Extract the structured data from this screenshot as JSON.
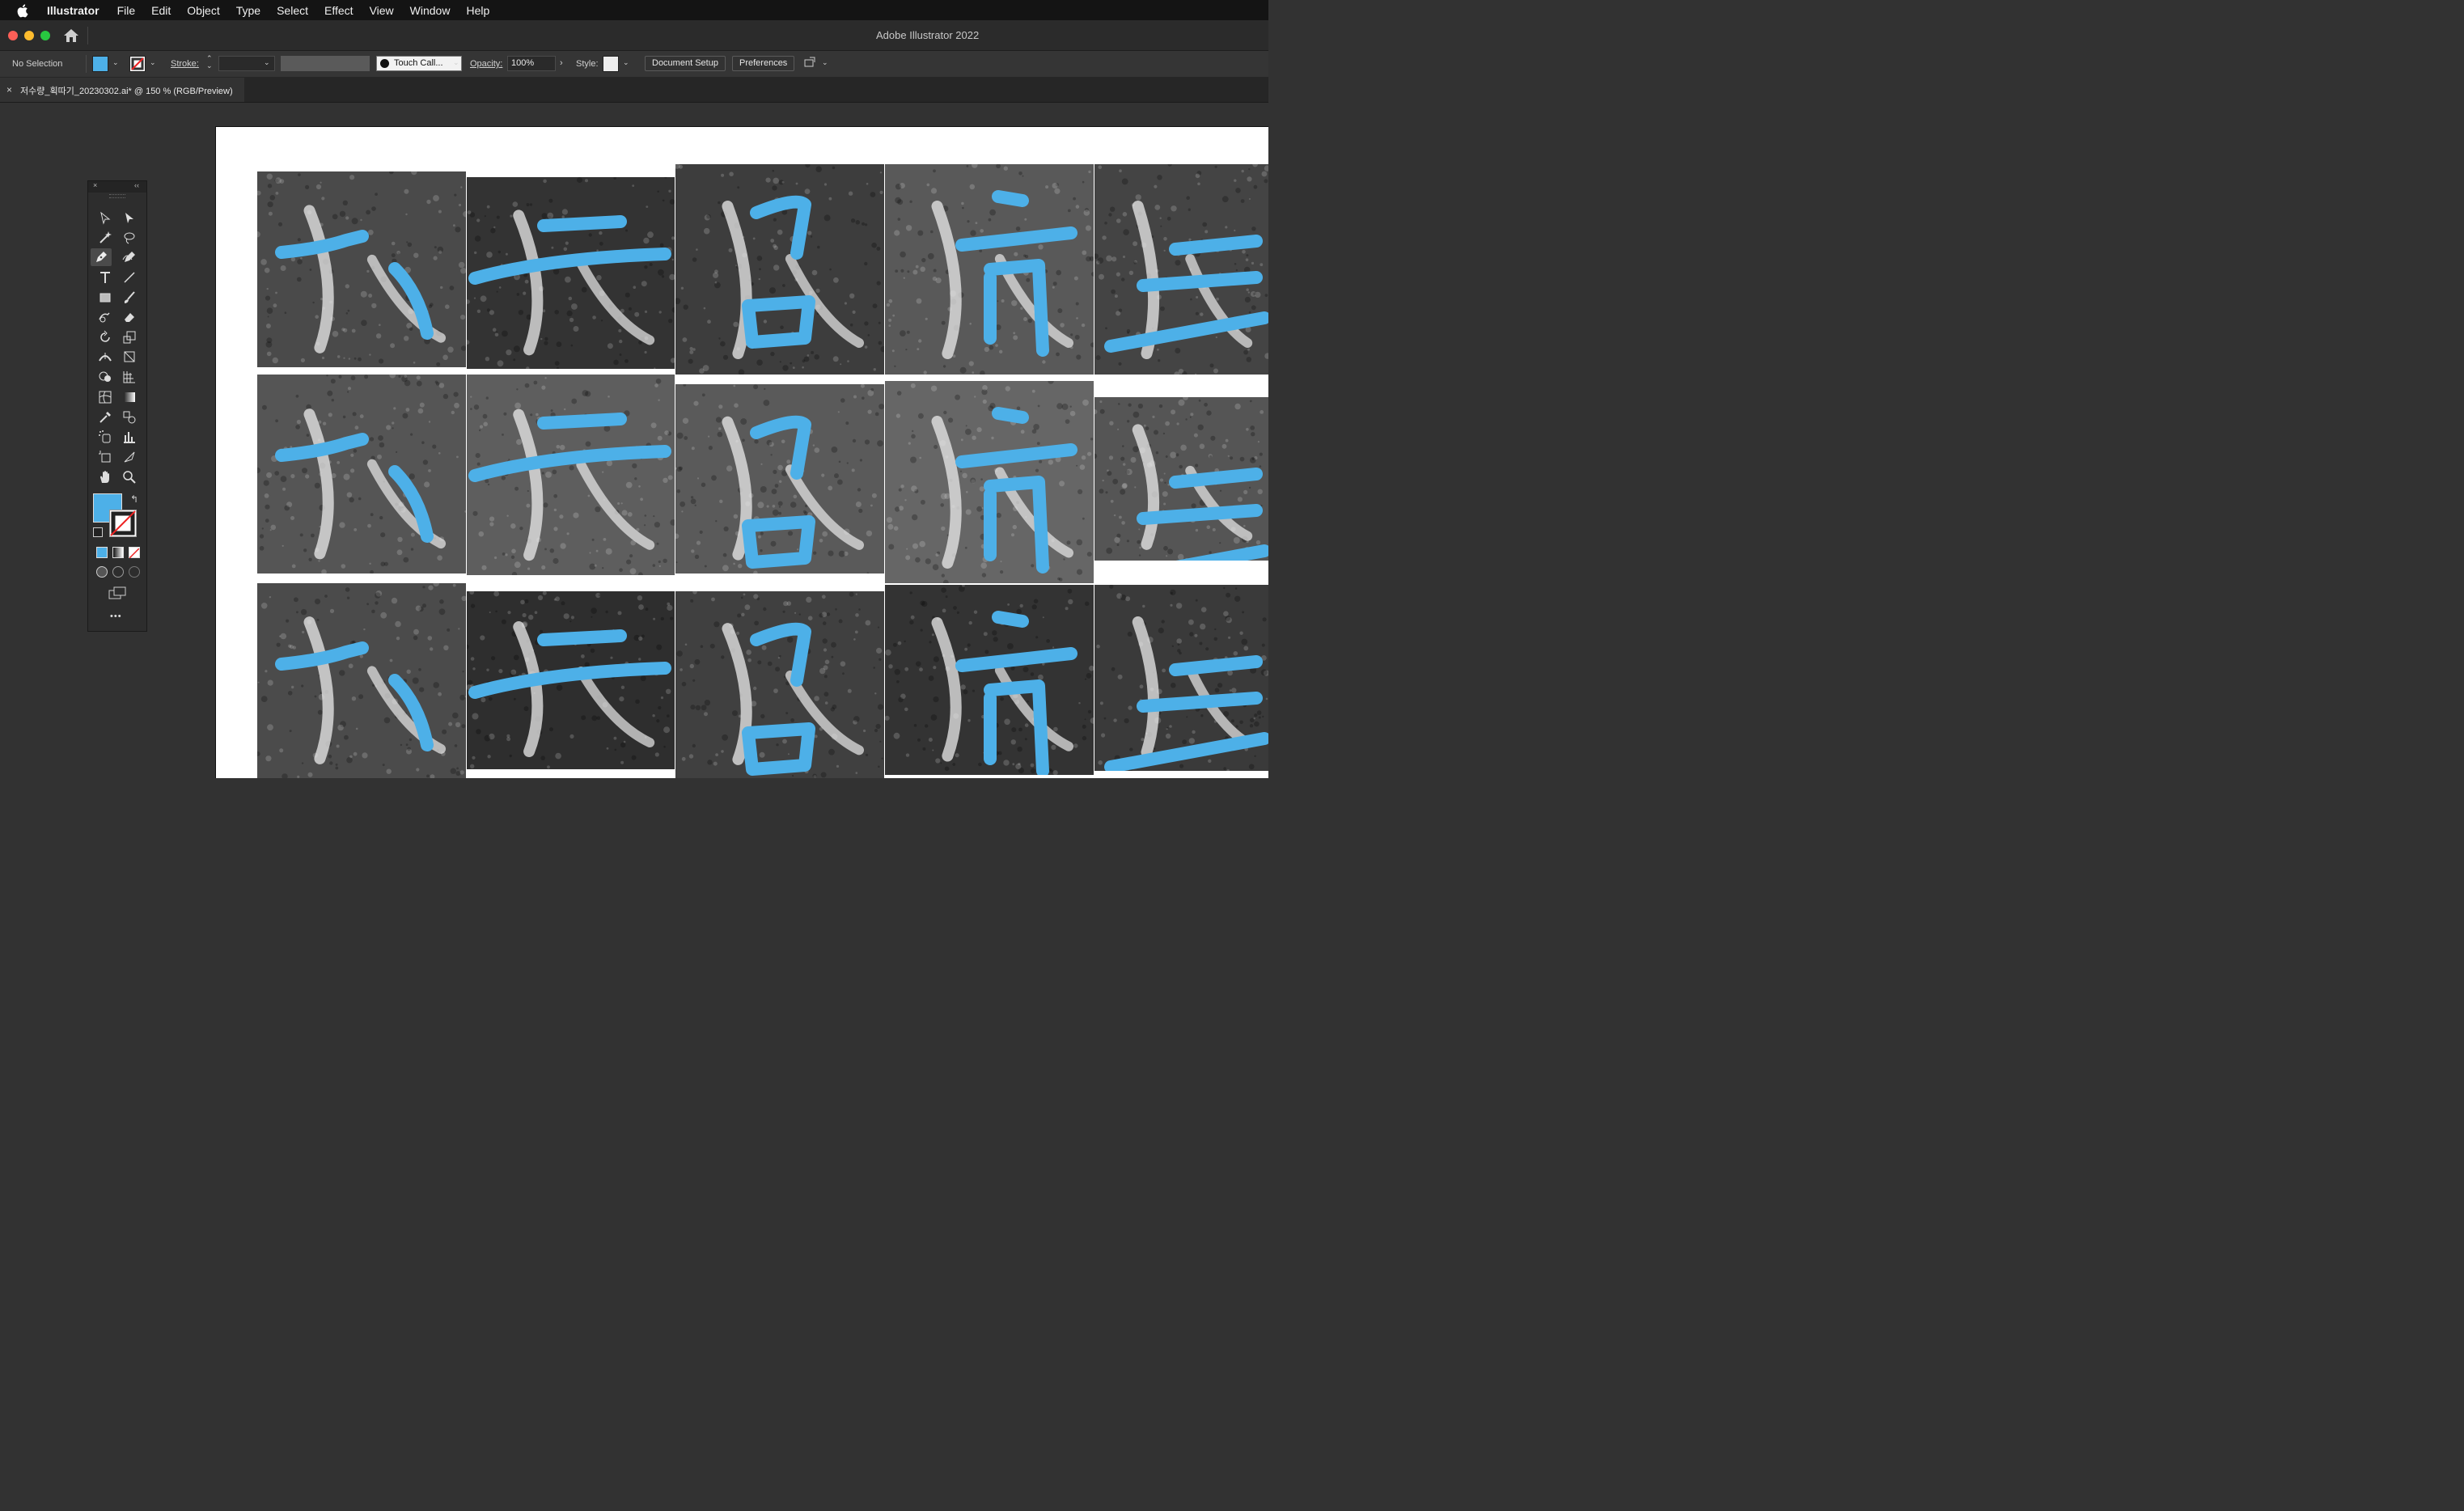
{
  "menubar": {
    "app_name": "Illustrator",
    "items": [
      "File",
      "Edit",
      "Object",
      "Type",
      "Select",
      "Effect",
      "View",
      "Window",
      "Help"
    ]
  },
  "titlebar": {
    "title": "Adobe Illustrator 2022"
  },
  "control_bar": {
    "selection": "No Selection",
    "stroke_label": "Stroke:",
    "brush_label": "Touch Call...",
    "opacity_label": "Opacity:",
    "opacity_value": "100%",
    "style_label": "Style:",
    "document_setup": "Document Setup",
    "preferences": "Preferences"
  },
  "document_tab": {
    "close": "×",
    "title": "저수량_획따기_20230302.ai* @ 150 % (RGB/Preview)"
  },
  "toolbox": {
    "close": "×",
    "collapse": "‹‹",
    "more": "•••"
  },
  "colors": {
    "fill": "#4db0e8",
    "stroke_overlay": "#4db0e8",
    "ui_dark": "#323232",
    "menubar": "#141414"
  },
  "canvas": {
    "description_visible": false,
    "tiles": [
      {
        "id": "t1"
      },
      {
        "id": "t2"
      },
      {
        "id": "t3"
      },
      {
        "id": "t4"
      },
      {
        "id": "t5"
      },
      {
        "id": "t6"
      },
      {
        "id": "t7"
      },
      {
        "id": "t8"
      },
      {
        "id": "t9"
      },
      {
        "id": "t10"
      },
      {
        "id": "t11"
      },
      {
        "id": "t12"
      },
      {
        "id": "t13"
      },
      {
        "id": "t14"
      },
      {
        "id": "t15"
      }
    ]
  }
}
